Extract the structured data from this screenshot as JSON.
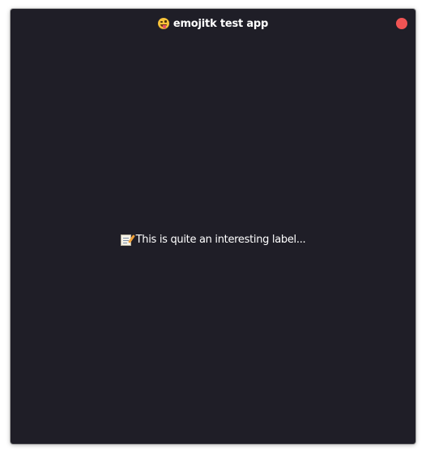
{
  "window": {
    "title": "emojitk test app",
    "title_icon": "face-with-tongue-icon",
    "close_icon": "close-icon",
    "background_color": "#1f1e27",
    "close_button_color": "#f05454"
  },
  "content": {
    "label_icon": "memo-icon",
    "label_text": "This is quite an interesting label..."
  }
}
